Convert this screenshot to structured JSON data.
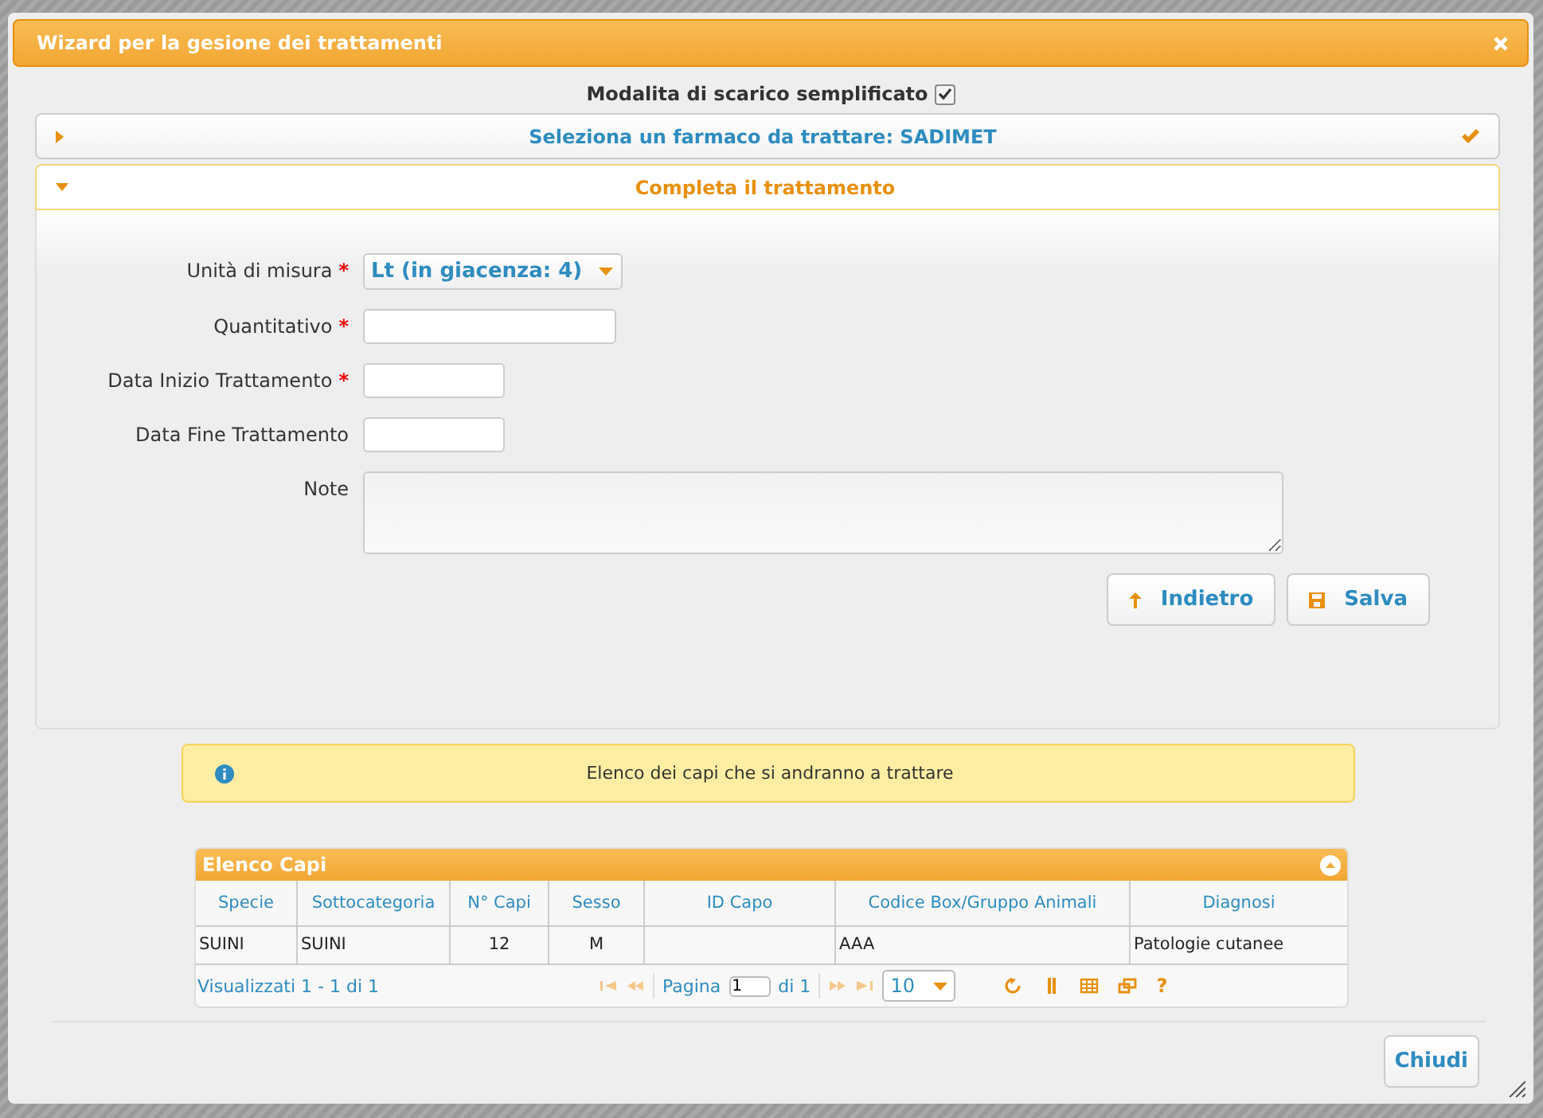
{
  "dialog": {
    "title": "Wizard per la gesione dei trattamenti",
    "simplified_mode": {
      "label": "Modalita di scarico semplificato",
      "checked": true
    },
    "accordion": [
      {
        "title": "Seleziona un farmaco da trattare: SADIMET",
        "expanded": false,
        "completed": true
      },
      {
        "title": "Completa il trattamento",
        "expanded": true,
        "completed": false
      }
    ],
    "form": {
      "required_mark": "*",
      "fields": [
        {
          "label": "Unità di misura",
          "required": true,
          "kind": "select",
          "value": "Lt (in giacenza: 4)"
        },
        {
          "label": "Quantitativo",
          "required": true,
          "kind": "text"
        },
        {
          "label": "Data Inizio Trattamento",
          "required": true,
          "kind": "date"
        },
        {
          "label": "Data Fine Trattamento",
          "required": false,
          "kind": "date"
        },
        {
          "label": "Note",
          "required": false,
          "kind": "textarea"
        }
      ],
      "buttons": [
        {
          "label": "Indietro",
          "kind": "back"
        },
        {
          "label": "Salva",
          "kind": "save"
        }
      ]
    },
    "info": "Elenco dei capi che si andranno a trattare",
    "grid": {
      "title": "Elenco Capi",
      "columns": [
        "Specie",
        "Sottocategoria",
        "N° Capi",
        "Sesso",
        "ID Capo",
        "Codice Box/Gruppo Animali",
        "Diagnosi"
      ],
      "rows": [
        [
          "SUINI",
          "SUINI",
          "12",
          "M",
          null,
          "AAA",
          "Patologie cutanee"
        ]
      ],
      "pager": {
        "summary": "Visualizzati 1 - 1 di 1",
        "page_label": "Pagina",
        "page": "1",
        "of": "di 1",
        "page_size": "10",
        "help": "?"
      }
    },
    "buttons": [
      "Chiudi"
    ]
  }
}
